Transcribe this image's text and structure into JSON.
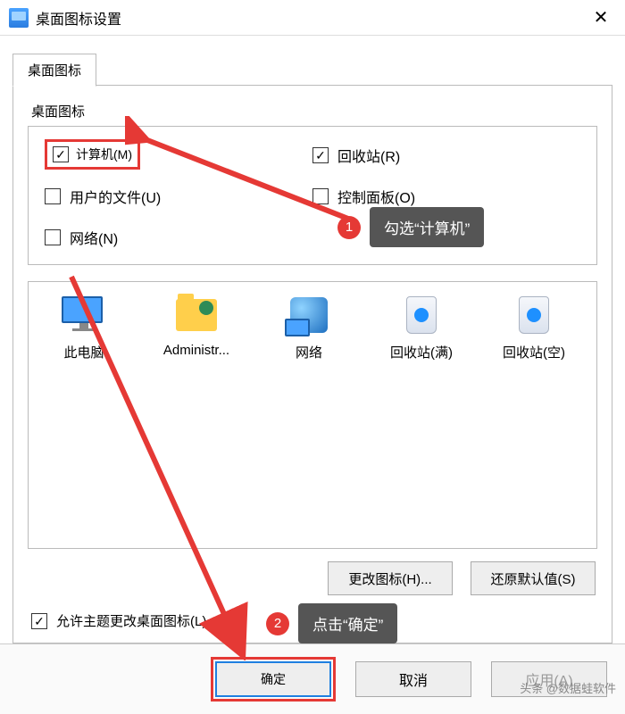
{
  "window": {
    "title": "桌面图标设置"
  },
  "tab": {
    "label": "桌面图标"
  },
  "group": {
    "label": "桌面图标"
  },
  "checks": {
    "computer": {
      "label": "计算机(M)",
      "checked": true
    },
    "recycle": {
      "label": "回收站(R)",
      "checked": true
    },
    "userfiles": {
      "label": "用户的文件(U)",
      "checked": false
    },
    "ctrlpanel": {
      "label": "控制面板(O)",
      "checked": false
    },
    "network": {
      "label": "网络(N)",
      "checked": false
    }
  },
  "icons": [
    {
      "key": "pc",
      "label": "此电脑"
    },
    {
      "key": "admin",
      "label": "Administr..."
    },
    {
      "key": "net",
      "label": "网络"
    },
    {
      "key": "binf",
      "label": "回收站(满)"
    },
    {
      "key": "bine",
      "label": "回收站(空)"
    }
  ],
  "buttons": {
    "changeIcon": "更改图标(H)...",
    "restore": "还原默认值(S)",
    "ok": "确定",
    "cancel": "取消",
    "apply": "应用(A)"
  },
  "themeCheck": {
    "label": "允许主题更改桌面图标(L)",
    "checked": true
  },
  "annotations": {
    "a1": {
      "num": "1",
      "text": "勾选“计算机”"
    },
    "a2": {
      "num": "2",
      "text": "点击“确定”"
    }
  },
  "watermark": "头条 @数据蛙软件"
}
